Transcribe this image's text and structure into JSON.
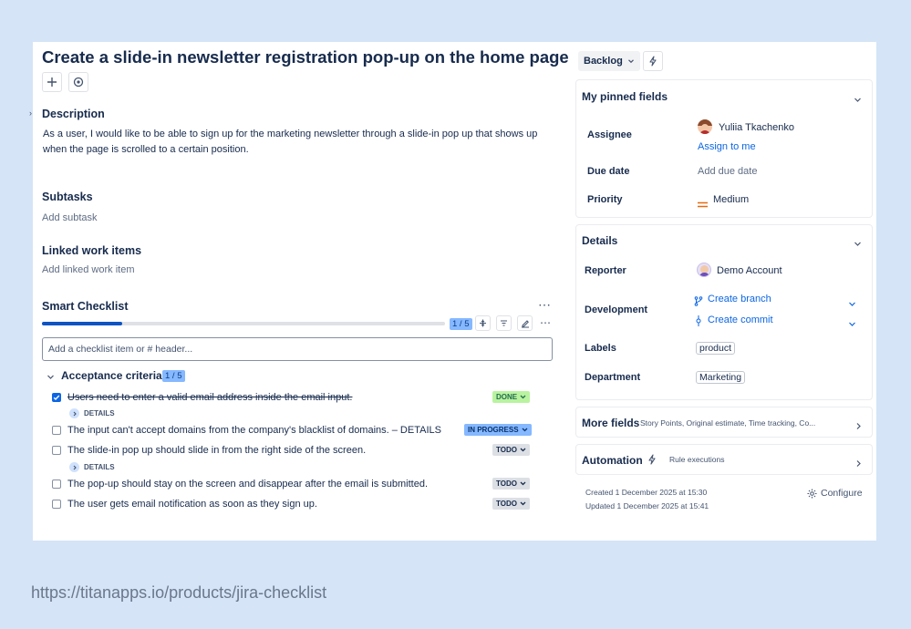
{
  "issue": {
    "title": "Create a slide-in newsletter registration pop-up on the home page",
    "description_heading": "Description",
    "description_text": "As a user, I would like to be able to sign up for the marketing newsletter through a slide-in pop up that shows up when the page is scrolled to a certain position.",
    "subtasks_heading": "Subtasks",
    "add_subtask": "Add subtask",
    "linked_heading": "Linked work items",
    "add_linked": "Add linked work item"
  },
  "checklist": {
    "heading": "Smart Checklist",
    "progress_text": "1 / 5",
    "progress_fraction": 0.2,
    "input_placeholder": "Add a checklist item or # header...",
    "section_title": "Acceptance criteria",
    "section_count": "1 / 5",
    "details_label": "DETAILS",
    "items": [
      {
        "text": "Users need to enter a valid email address inside the email input.",
        "status": "DONE",
        "checked": true
      },
      {
        "text": "The input can't accept domains from the company's blacklist of domains. – DETAILS",
        "status": "IN PROGRESS",
        "checked": false
      },
      {
        "text": "The slide-in pop up should slide in from the right side of the screen.",
        "status": "TODO",
        "checked": false
      },
      {
        "text": "The pop-up should stay on the screen and disappear after the email is submitted.",
        "status": "TODO",
        "checked": false
      },
      {
        "text": "The user gets email notification as soon as they sign up.",
        "status": "TODO",
        "checked": false
      }
    ]
  },
  "sidebar": {
    "status_button": "Backlog",
    "pinned_heading": "My pinned fields",
    "assignee_label": "Assignee",
    "assignee_name": "Yuliia Tkachenko",
    "assign_to_me": "Assign to me",
    "due_label": "Due date",
    "due_value": "Add due date",
    "priority_label": "Priority",
    "priority_value": "Medium",
    "details_heading": "Details",
    "reporter_label": "Reporter",
    "reporter_name": "Demo Account",
    "development_label": "Development",
    "create_branch": "Create branch",
    "create_commit": "Create commit",
    "labels_label": "Labels",
    "labels_value": "product",
    "department_label": "Department",
    "department_value": "Marketing",
    "more_fields_heading": "More fields",
    "more_fields_sub": "Story Points, Original estimate, Time tracking, Co...",
    "automation_heading": "Automation",
    "automation_sub": "Rule executions",
    "created": "Created 1 December 2025 at 15:30",
    "updated": "Updated 1 December 2025 at 15:41",
    "configure": "Configure"
  },
  "footer": {
    "url": "https://titanapps.io/products/jira-checklist"
  },
  "colors": {
    "background": "#d5e4f7",
    "progress": "#0c53c4",
    "done": "#baf3a0",
    "in_progress": "#85b8ff",
    "todo": "#dcdfe4",
    "priority_medium": "#e56910"
  }
}
